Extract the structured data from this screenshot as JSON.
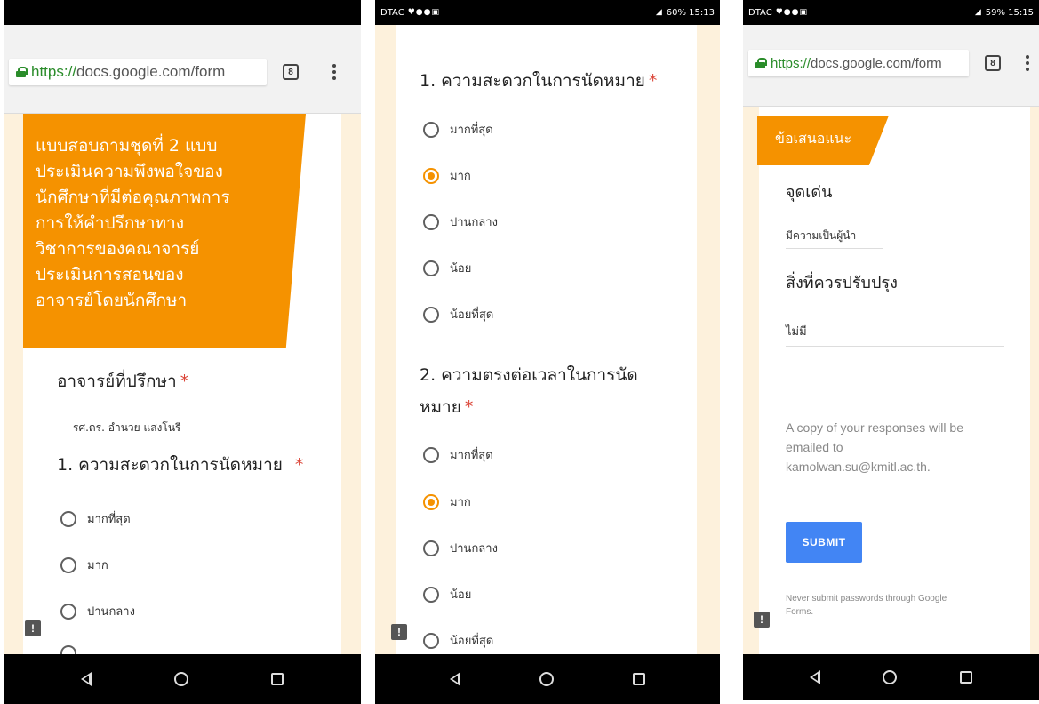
{
  "colors": {
    "accent": "#f59200",
    "secure": "#2a8c2a",
    "required": "#db4437",
    "submit": "#4285f4"
  },
  "p1": {
    "url_secure": "https://",
    "url_rest": "docs.google.com/form",
    "tabs_count": "8",
    "header_lines": [
      "แบบสอบถามชุดที่ 2 แบบ",
      "ประเมินความพึงพอใจของ",
      "นักศึกษาที่มีต่อคุณภาพการ",
      "การให้คำปรึกษาทาง",
      "วิชาการของคณาจารย์",
      "ประเมินการสอนของ",
      "อาจารย์โดยนักศึกษา"
    ],
    "advisor_label": "อาจารย์ที่ปรึกษา",
    "required_mark": "*",
    "advisor_value": "รศ.ดร. อำนวย แสงโนรี",
    "q1": "1. ความสะดวกในการนัดหมาย",
    "options": [
      "มากที่สุด",
      "มาก",
      "ปานกลาง"
    ]
  },
  "p2": {
    "status_left": "DTAC",
    "status_right": "60% 15:13",
    "q1": "1. ความสะดวกในการนัดหมาย",
    "q1_options": [
      "มากที่สุด",
      "มาก",
      "ปานกลาง",
      "น้อย",
      "น้อยที่สุด"
    ],
    "q2_line1": "2. ความตรงต่อเวลาในการนัด",
    "q2_line2": "หมาย",
    "required_mark": "*",
    "q2_options": [
      "มากที่สุด",
      "มาก",
      "ปานกลาง",
      "น้อย",
      "น้อยที่สุด"
    ]
  },
  "p3": {
    "status_left": "DTAC",
    "status_right": "59% 15:15",
    "url_secure": "https://",
    "url_rest": "docs.google.com/form",
    "tabs_count": "8",
    "section_title": "ข้อเสนอแนะ",
    "strength_label": "จุดเด่น",
    "strength_value": "มีความเป็นผู้นำ",
    "improve_label": "สิ่งที่ควรปรับปรุง",
    "improve_value": "ไม่มี",
    "copy_line1": "A copy of your responses will be",
    "copy_line2": "emailed to",
    "copy_line3": "kamolwan.su@kmitl.ac.th.",
    "submit_label": "SUBMIT",
    "never_line1": "Never submit passwords through Google",
    "never_line2": "Forms."
  }
}
